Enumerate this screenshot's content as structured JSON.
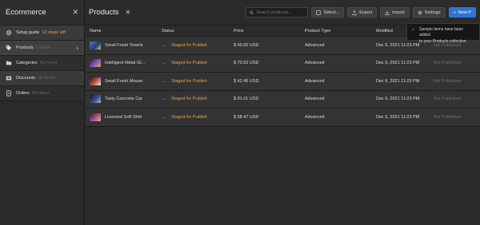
{
  "sidebar": {
    "title": "Ecommerce",
    "items": [
      {
        "label": "Setup guide",
        "sub": "12 steps left"
      },
      {
        "label": "Products",
        "sub": "5 items"
      },
      {
        "label": "Categories",
        "sub": "No items"
      },
      {
        "label": "Discounts",
        "sub": "No items"
      },
      {
        "label": "Orders",
        "sub": "No items"
      }
    ]
  },
  "header": {
    "title": "Products",
    "search_placeholder": "Search products...",
    "select_label": "Select...",
    "export_label": "Export",
    "import_label": "Import",
    "settings_label": "Settings",
    "new_label": "New P"
  },
  "table": {
    "columns": [
      "Name",
      "Status",
      "Price",
      "Product Type",
      "Modified",
      ""
    ],
    "rows": [
      {
        "name": "Small Fresh Towels",
        "status": "Staged for Publish",
        "price": "$ 40.65 USD",
        "type": "Advanced",
        "modified": "Dec 9, 2021 11:23 PM",
        "published": "Not Published",
        "thumb_color": "#3b5b9a"
      },
      {
        "name": "Intelligent Metal Gl...",
        "status": "Staged for Publish",
        "price": "$ 70.53 USD",
        "type": "Advanced",
        "modified": "Dec 9, 2021 11:23 PM",
        "published": "Not Published",
        "thumb_color": "#6a4a8e"
      },
      {
        "name": "Small Fresh Mouse",
        "status": "Staged for Publish",
        "price": "$ 42.45 USD",
        "type": "Advanced",
        "modified": "Dec 9, 2021 11:23 PM",
        "published": "Not Published",
        "thumb_color": "#8a3a2c"
      },
      {
        "name": "Tasty Concrete Car",
        "status": "Staged for Publish",
        "price": "$ 81.01 USD",
        "type": "Advanced",
        "modified": "Dec 9, 2021 11:23 PM",
        "published": "Not Published",
        "thumb_color": "#2f3f6e"
      },
      {
        "name": "Licensed Soft Shirt",
        "status": "Staged for Publish",
        "price": "$ 58.47 USD",
        "type": "Advanced",
        "modified": "Dec 9, 2021 11:23 PM",
        "published": "Not Published",
        "thumb_color": "#7a3d6b"
      }
    ]
  },
  "toast": {
    "message_line1": "Sample items have been added",
    "message_line2": "to your Products collection."
  },
  "colors": {
    "accent": "#2d75d6",
    "status_staged": "#e8a73a",
    "toast_check": "#34c36c"
  }
}
